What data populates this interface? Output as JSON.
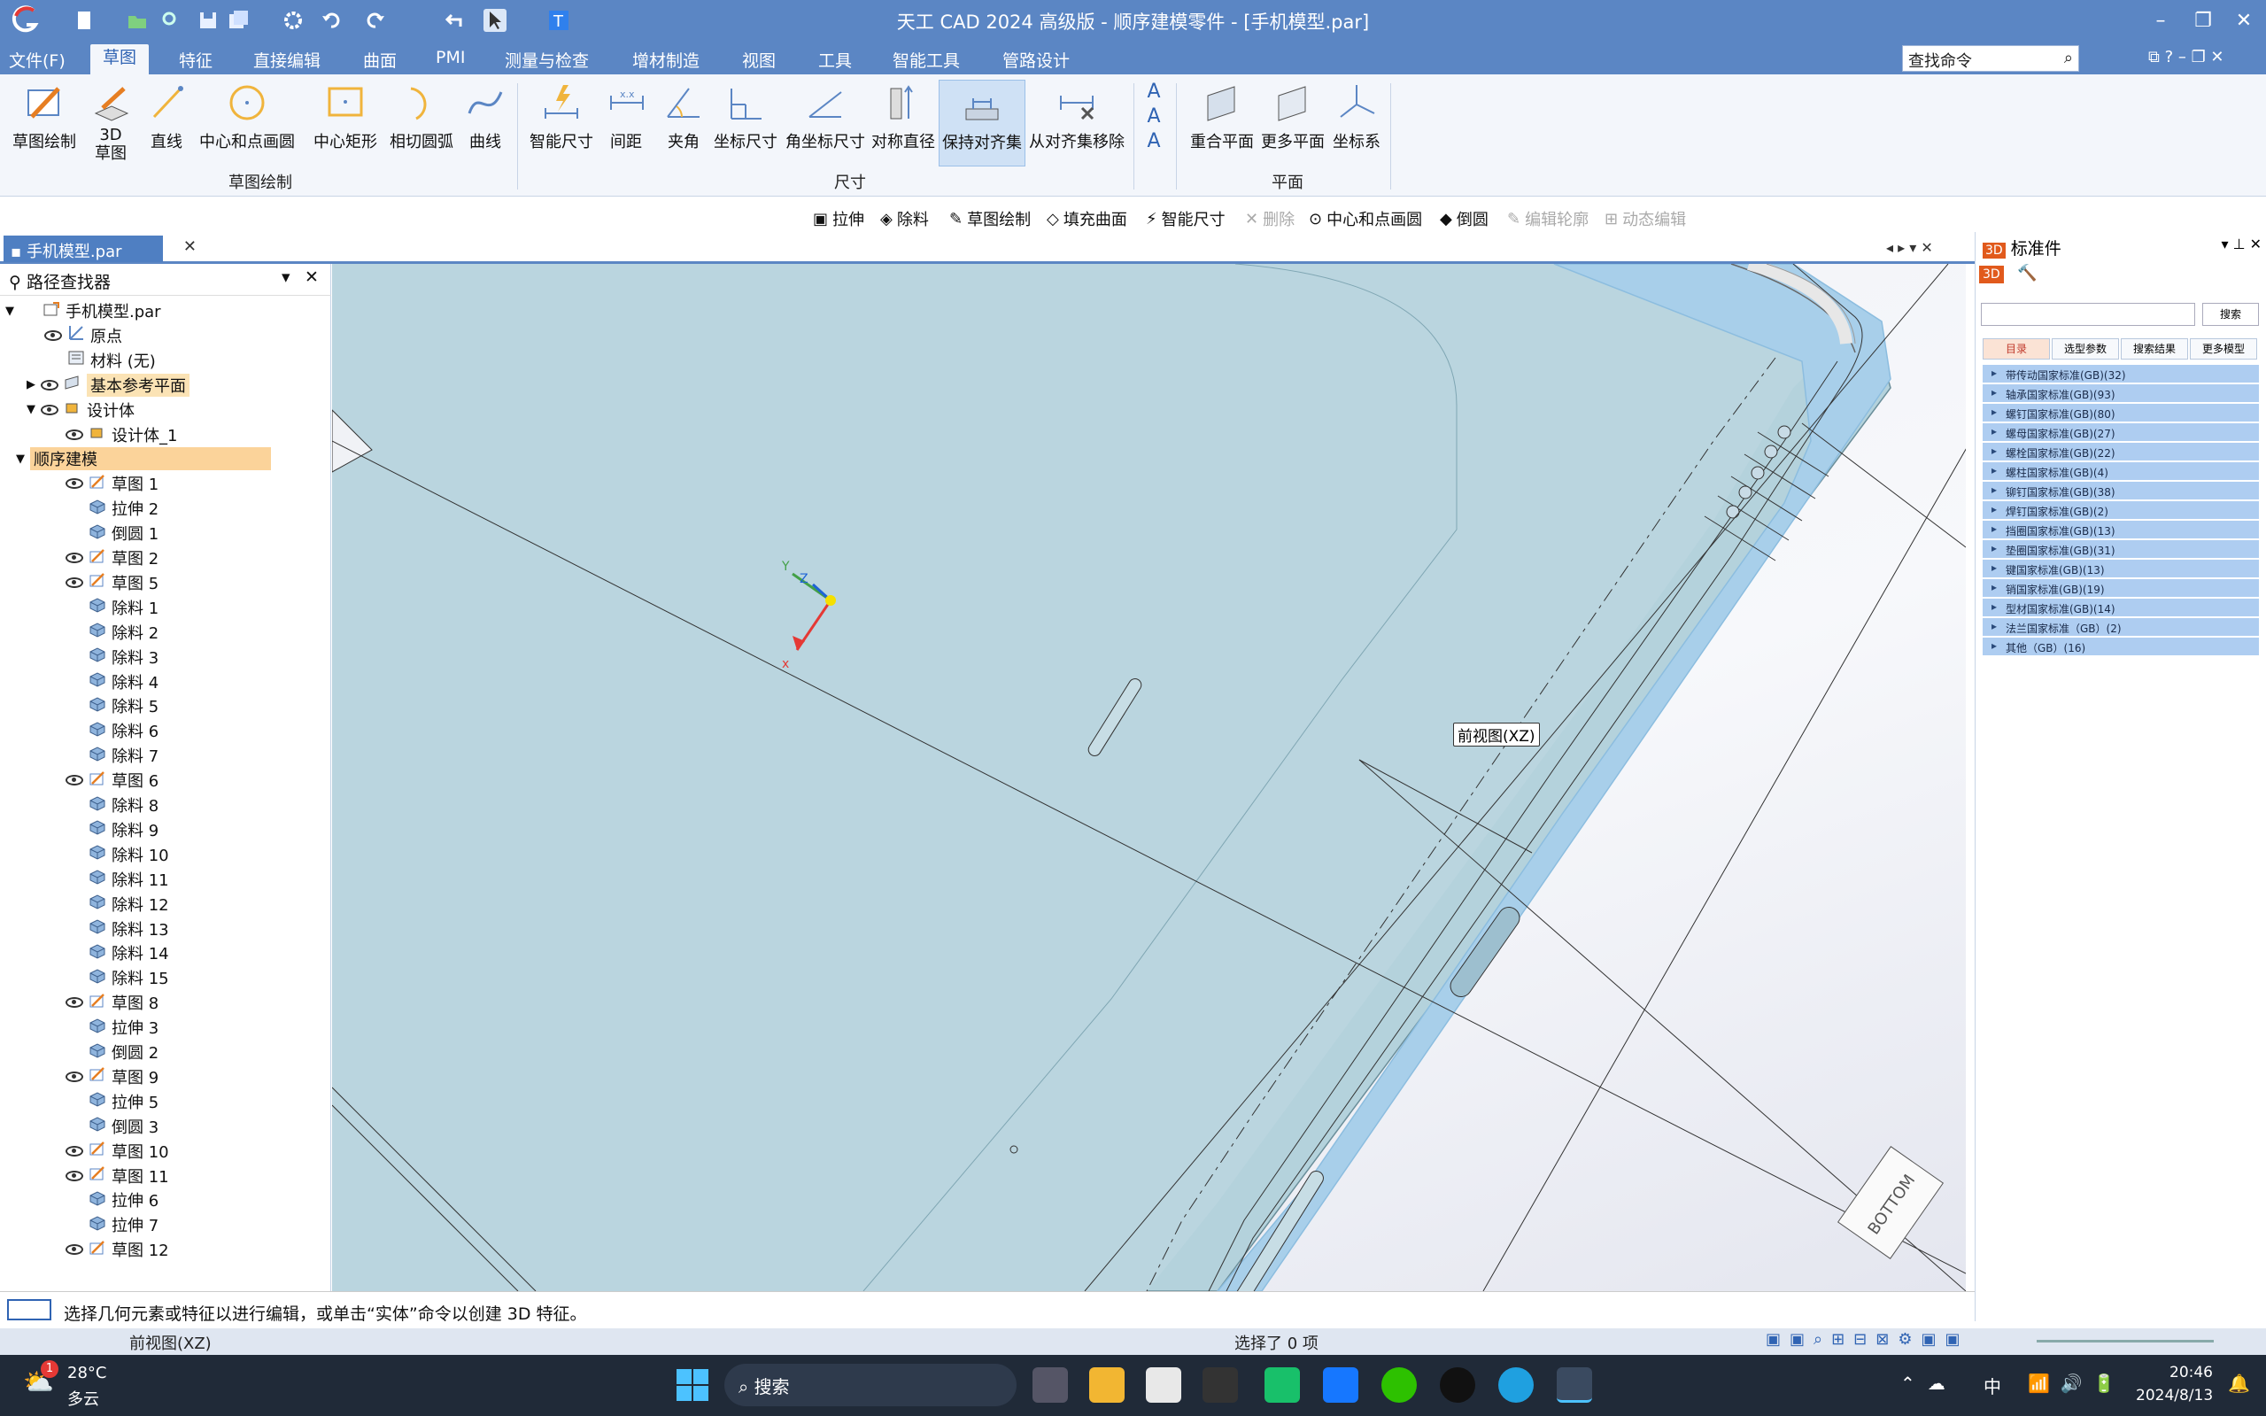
{
  "window": {
    "title": "天工 CAD 2024 高级版 - 顺序建模零件 - [手机模型.par]"
  },
  "menu": {
    "file": "文件(F)",
    "items": [
      "草图",
      "特征",
      "直接编辑",
      "曲面",
      "PMI",
      "测量与检查",
      "增材制造",
      "视图",
      "工具",
      "智能工具",
      "管路设计"
    ],
    "active_index": 0,
    "search_placeholder": "查找命令"
  },
  "ribbon": {
    "sketch_draw": "草图绘制",
    "sketch3d": "3D",
    "sketch3d_2": "草图",
    "line": "直线",
    "circle": "中心和点画圆",
    "rect": "中心矩形",
    "arc": "相切圆弧",
    "curve": "曲线",
    "group_sketch": "草图绘制",
    "smart_dim": "智能尺寸",
    "distance": "间距",
    "angle": "夹角",
    "coord_dim": "坐标尺寸",
    "angle_coord_dim": "角坐标尺寸",
    "sym_dia": "对称直径",
    "keep_align": "保持对齐集",
    "remove_align": "从对齐集移除",
    "group_dim": "尺寸",
    "coincident_plane": "重合平面",
    "more_planes": "更多平面",
    "coord_sys": "坐标系",
    "group_plane": "平面"
  },
  "cmdbar": {
    "extrude": "拉伸",
    "cut": "除料",
    "sketch": "草图绘制",
    "fill_surface": "填充曲面",
    "smart_dim": "智能尺寸",
    "delete": "删除",
    "circle": "中心和点画圆",
    "round": "倒圆",
    "edit_profile": "编辑轮廓",
    "dynamic_edit": "动态编辑"
  },
  "doc_tab": "手机模型.par",
  "pathfinder": {
    "title": "路径查找器",
    "items": [
      {
        "label": "手机模型.par",
        "level": 0,
        "eye": false,
        "icon": "part"
      },
      {
        "label": "原点",
        "level": 1,
        "eye": true,
        "icon": "origin"
      },
      {
        "label": "材料 (无)",
        "level": 1,
        "eye": false,
        "icon": "material"
      },
      {
        "label": "基本参考平面",
        "level": 1,
        "eye": true,
        "icon": "plane",
        "highlight": true,
        "expand": "right"
      },
      {
        "label": "设计体",
        "level": 1,
        "eye": true,
        "icon": "body",
        "expand": "down"
      },
      {
        "label": "设计体_1",
        "level": 2,
        "eye": true,
        "icon": "body"
      },
      {
        "label": "顺序建模",
        "level": 0,
        "eye": false,
        "icon": "none",
        "section": true,
        "expand": "down"
      },
      {
        "label": "草图 1",
        "level": 2,
        "eye": true,
        "icon": "sketch"
      },
      {
        "label": "拉伸 2",
        "level": 2,
        "eye": false,
        "icon": "feature"
      },
      {
        "label": "倒圆 1",
        "level": 2,
        "eye": false,
        "icon": "feature"
      },
      {
        "label": "草图 2",
        "level": 2,
        "eye": true,
        "icon": "sketch"
      },
      {
        "label": "草图 5",
        "level": 2,
        "eye": true,
        "icon": "sketch"
      },
      {
        "label": "除料 1",
        "level": 2,
        "eye": false,
        "icon": "feature"
      },
      {
        "label": "除料 2",
        "level": 2,
        "eye": false,
        "icon": "feature"
      },
      {
        "label": "除料 3",
        "level": 2,
        "eye": false,
        "icon": "feature"
      },
      {
        "label": "除料 4",
        "level": 2,
        "eye": false,
        "icon": "feature"
      },
      {
        "label": "除料 5",
        "level": 2,
        "eye": false,
        "icon": "feature"
      },
      {
        "label": "除料 6",
        "level": 2,
        "eye": false,
        "icon": "feature"
      },
      {
        "label": "除料 7",
        "level": 2,
        "eye": false,
        "icon": "feature"
      },
      {
        "label": "草图 6",
        "level": 2,
        "eye": true,
        "icon": "sketch"
      },
      {
        "label": "除料 8",
        "level": 2,
        "eye": false,
        "icon": "feature"
      },
      {
        "label": "除料 9",
        "level": 2,
        "eye": false,
        "icon": "feature"
      },
      {
        "label": "除料 10",
        "level": 2,
        "eye": false,
        "icon": "feature"
      },
      {
        "label": "除料 11",
        "level": 2,
        "eye": false,
        "icon": "feature"
      },
      {
        "label": "除料 12",
        "level": 2,
        "eye": false,
        "icon": "feature"
      },
      {
        "label": "除料 13",
        "level": 2,
        "eye": false,
        "icon": "feature"
      },
      {
        "label": "除料 14",
        "level": 2,
        "eye": false,
        "icon": "feature"
      },
      {
        "label": "除料 15",
        "level": 2,
        "eye": false,
        "icon": "feature"
      },
      {
        "label": "草图 8",
        "level": 2,
        "eye": true,
        "icon": "sketch"
      },
      {
        "label": "拉伸 3",
        "level": 2,
        "eye": false,
        "icon": "feature"
      },
      {
        "label": "倒圆 2",
        "level": 2,
        "eye": false,
        "icon": "feature"
      },
      {
        "label": "草图 9",
        "level": 2,
        "eye": true,
        "icon": "sketch"
      },
      {
        "label": "拉伸 5",
        "level": 2,
        "eye": false,
        "icon": "feature"
      },
      {
        "label": "倒圆 3",
        "level": 2,
        "eye": false,
        "icon": "feature"
      },
      {
        "label": "草图 10",
        "level": 2,
        "eye": true,
        "icon": "sketch"
      },
      {
        "label": "草图 11",
        "level": 2,
        "eye": true,
        "icon": "sketch"
      },
      {
        "label": "拉伸 6",
        "level": 2,
        "eye": false,
        "icon": "feature"
      },
      {
        "label": "拉伸 7",
        "level": 2,
        "eye": false,
        "icon": "feature"
      },
      {
        "label": "草图 12",
        "level": 2,
        "eye": true,
        "icon": "sketch"
      }
    ]
  },
  "viewport": {
    "view_label": "前视图(XZ)",
    "cube_face": "BOTTOM",
    "axis_x": "x",
    "axis_y": "Y",
    "axis_z": "Z"
  },
  "std_panel": {
    "title": "标准件",
    "search_btn": "搜索",
    "tabs": [
      "目录",
      "选型参数",
      "搜索结果",
      "更多模型"
    ],
    "rows": [
      "带传动国家标准(GB)(32)",
      "轴承国家标准(GB)(93)",
      "螺钉国家标准(GB)(80)",
      "螺母国家标准(GB)(27)",
      "螺栓国家标准(GB)(22)",
      "螺柱国家标准(GB)(4)",
      "铆钉国家标准(GB)(38)",
      "焊钉国家标准(GB)(2)",
      "挡圈国家标准(GB)(13)",
      "垫圈国家标准(GB)(31)",
      "键国家标准(GB)(13)",
      "销国家标准(GB)(19)",
      "型材国家标准(GB)(14)",
      "法兰国家标准（GB）(2)",
      "其他（GB）(16)"
    ]
  },
  "prompt": "选择几何元素或特征以进行编辑，或单击“实体”命令以创建 3D 特征。",
  "status": {
    "left": "前视图(XZ)",
    "center": "选择了 0 项"
  },
  "taskbar": {
    "temp": "28°C",
    "weather": "多云",
    "badge": "1",
    "search": "搜索",
    "time": "20:46",
    "date": "2024/8/13",
    "ime": "中"
  },
  "colors": {
    "accent": "#5b86c4",
    "model_face": "#b4d2dc",
    "model_edge": "#a8cfea",
    "tree_highlight": "#fbe3b5"
  }
}
